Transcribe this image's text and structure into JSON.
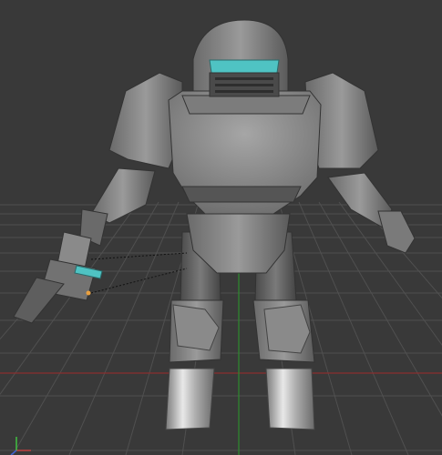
{
  "viewport": {
    "background": "#393939",
    "grid_color": "#505050",
    "axis_x_color": "#8a2f2f",
    "axis_y_color": "#2f8a2f",
    "axis_z_color": "#3050b0",
    "visor_color": "#4fc3c3"
  },
  "scene": {
    "model": "armored-mech-robot",
    "selected_object": "arm-cannon"
  },
  "gizmo": {
    "axes": [
      "x-axis",
      "y-axis",
      "z-axis"
    ]
  }
}
